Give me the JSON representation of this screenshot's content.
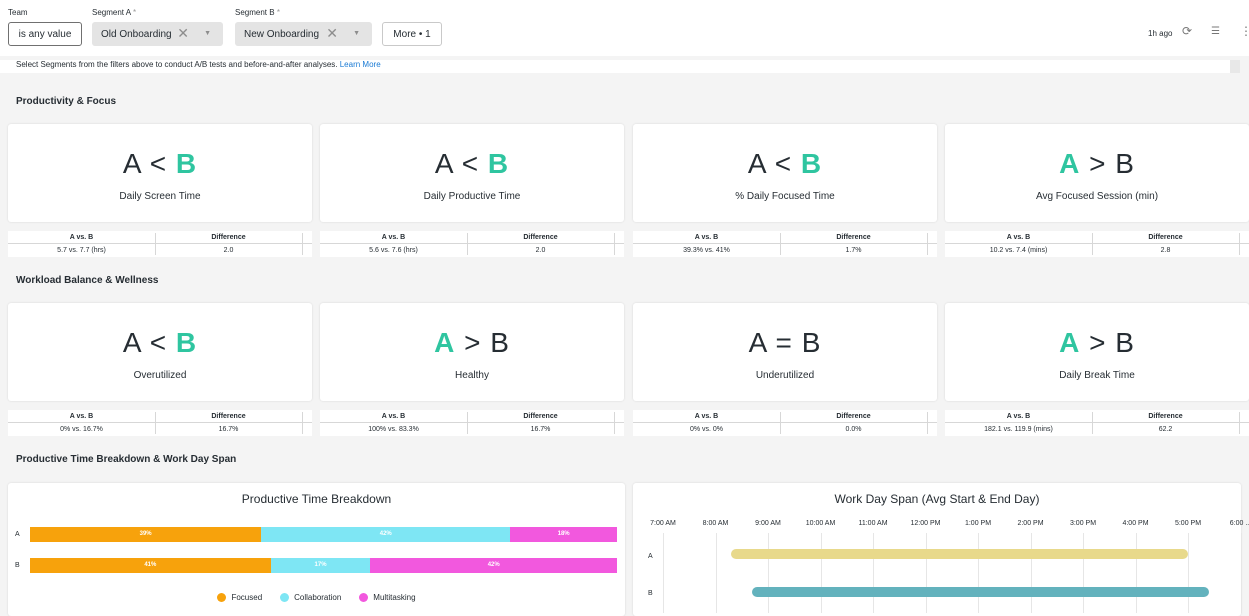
{
  "filters": {
    "team": {
      "label": "Team",
      "value": "is any value"
    },
    "segment_a": {
      "label": "Segment A",
      "required_mark": "*",
      "value": "Old Onboarding"
    },
    "segment_b": {
      "label": "Segment B",
      "required_mark": "*",
      "value": "New Onboarding"
    },
    "more": "More • 1",
    "clear_glyph": "✕",
    "caret_glyph": "▼"
  },
  "toolbar": {
    "last_updated": "1h ago",
    "refresh_glyph": "⟳",
    "filter_glyph": "☰",
    "menu_glyph": "⋮"
  },
  "notice": {
    "text": "Select Segments from the filters above to conduct A/B tests and before-and-after analyses. ",
    "link": "Learn More"
  },
  "table_headers": {
    "a_vs_b": "A vs. B",
    "difference": "Difference"
  },
  "sections": {
    "productivity": {
      "title": "Productivity & Focus",
      "cards": [
        {
          "left": "A",
          "op": "<",
          "right": "B",
          "winner": "B",
          "metric": "Daily Screen Time",
          "a_vs_b": "5.7 vs. 7.7 (hrs)",
          "difference": "2.0"
        },
        {
          "left": "A",
          "op": "<",
          "right": "B",
          "winner": "B",
          "metric": "Daily Productive Time",
          "a_vs_b": "5.6 vs. 7.6 (hrs)",
          "difference": "2.0"
        },
        {
          "left": "A",
          "op": "<",
          "right": "B",
          "winner": "B",
          "metric": "% Daily Focused Time",
          "a_vs_b": "39.3% vs. 41%",
          "difference": "1.7%"
        },
        {
          "left": "A",
          "op": ">",
          "right": "B",
          "winner": "A",
          "metric": "Avg Focused Session (min)",
          "a_vs_b": "10.2 vs. 7.4 (mins)",
          "difference": "2.8"
        }
      ]
    },
    "workload": {
      "title": "Workload Balance & Wellness",
      "cards": [
        {
          "left": "A",
          "op": "<",
          "right": "B",
          "winner": "B",
          "metric": "Overutilized",
          "a_vs_b": "0% vs. 16.7%",
          "difference": "16.7%"
        },
        {
          "left": "A",
          "op": ">",
          "right": "B",
          "winner": "A",
          "metric": "Healthy",
          "a_vs_b": "100% vs. 83.3%",
          "difference": "16.7%"
        },
        {
          "left": "A",
          "op": "=",
          "right": "B",
          "winner": "",
          "metric": "Underutilized",
          "a_vs_b": "0% vs. 0%",
          "difference": "0.0%"
        },
        {
          "left": "A",
          "op": ">",
          "right": "B",
          "winner": "A",
          "metric": "Daily Break Time",
          "a_vs_b": "182.1 vs. 119.9 (mins)",
          "difference": "62.2"
        }
      ]
    },
    "breakdown": {
      "title": "Productive Time Breakdown & Work Day Span"
    }
  },
  "colors": {
    "winner": "#2fc5a0",
    "focused": "#f7a20c",
    "collaboration": "#7ee6f4",
    "multitasking": "#f258de",
    "span_a": "#e8d98b",
    "span_b": "#63b2bd"
  },
  "chart_data": [
    {
      "type": "bar",
      "title": "Productive Time Breakdown",
      "categories": [
        "A",
        "B"
      ],
      "series": [
        {
          "name": "Focused",
          "values": [
            39,
            41
          ],
          "labels": [
            "39%",
            "41%"
          ]
        },
        {
          "name": "Collaboration",
          "values": [
            42,
            17
          ],
          "labels": [
            "42%",
            "17%"
          ]
        },
        {
          "name": "Multitasking",
          "values": [
            18,
            42
          ],
          "labels": [
            "18%",
            "42%"
          ]
        }
      ],
      "stacked": true,
      "orientation": "horizontal",
      "legend": "bottom"
    },
    {
      "type": "bar",
      "title": "Work Day Span (Avg Start & End Day)",
      "categories": [
        "A",
        "B"
      ],
      "x_ticks": [
        "7:00 AM",
        "8:00 AM",
        "9:00 AM",
        "10:00 AM",
        "11:00 AM",
        "12:00 PM",
        "1:00 PM",
        "2:00 PM",
        "3:00 PM",
        "4:00 PM",
        "5:00 PM",
        "6:00 ..."
      ],
      "xlim_hours": [
        7,
        18
      ],
      "spans_hours": [
        {
          "start": 8.3,
          "end": 17.0
        },
        {
          "start": 8.7,
          "end": 17.4
        }
      ],
      "orientation": "horizontal",
      "grid": true
    }
  ]
}
